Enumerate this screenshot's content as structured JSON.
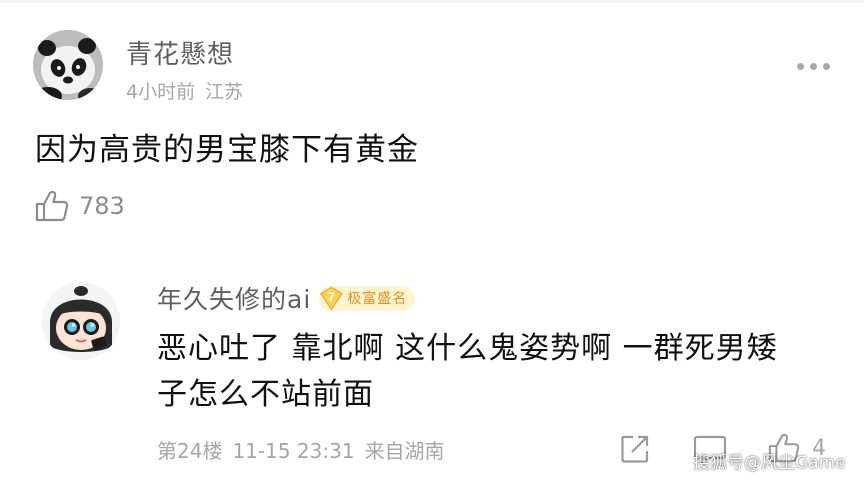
{
  "comment": {
    "username": "青花懸想",
    "time": "4小时前",
    "location": "江苏",
    "text": "因为高贵的男宝膝下有黄金",
    "like_count": "783"
  },
  "reply": {
    "username": "年久失修的ai",
    "level": "7",
    "badge_text": "极富盛名",
    "text_line1": "恶心吐了 靠北啊 这什么鬼姿势啊 一群死男矮",
    "text_line2": "子怎么不站前面",
    "floor": "第24楼",
    "datetime": "11-15 23:31",
    "source": "来自湖南",
    "like_count": "4"
  },
  "watermark": "搜狐号@风尘Game",
  "colors": {
    "username": "#5f5f5f",
    "meta": "#a6a6a6",
    "body": "#111111",
    "badge_bg": "#fff4cf",
    "badge_text": "#d9962a"
  },
  "icons": [
    "panda-avatar",
    "more-icon",
    "thumb-up-icon",
    "cartoon-avatar",
    "level-badge-icon",
    "share-icon",
    "comment-icon"
  ]
}
